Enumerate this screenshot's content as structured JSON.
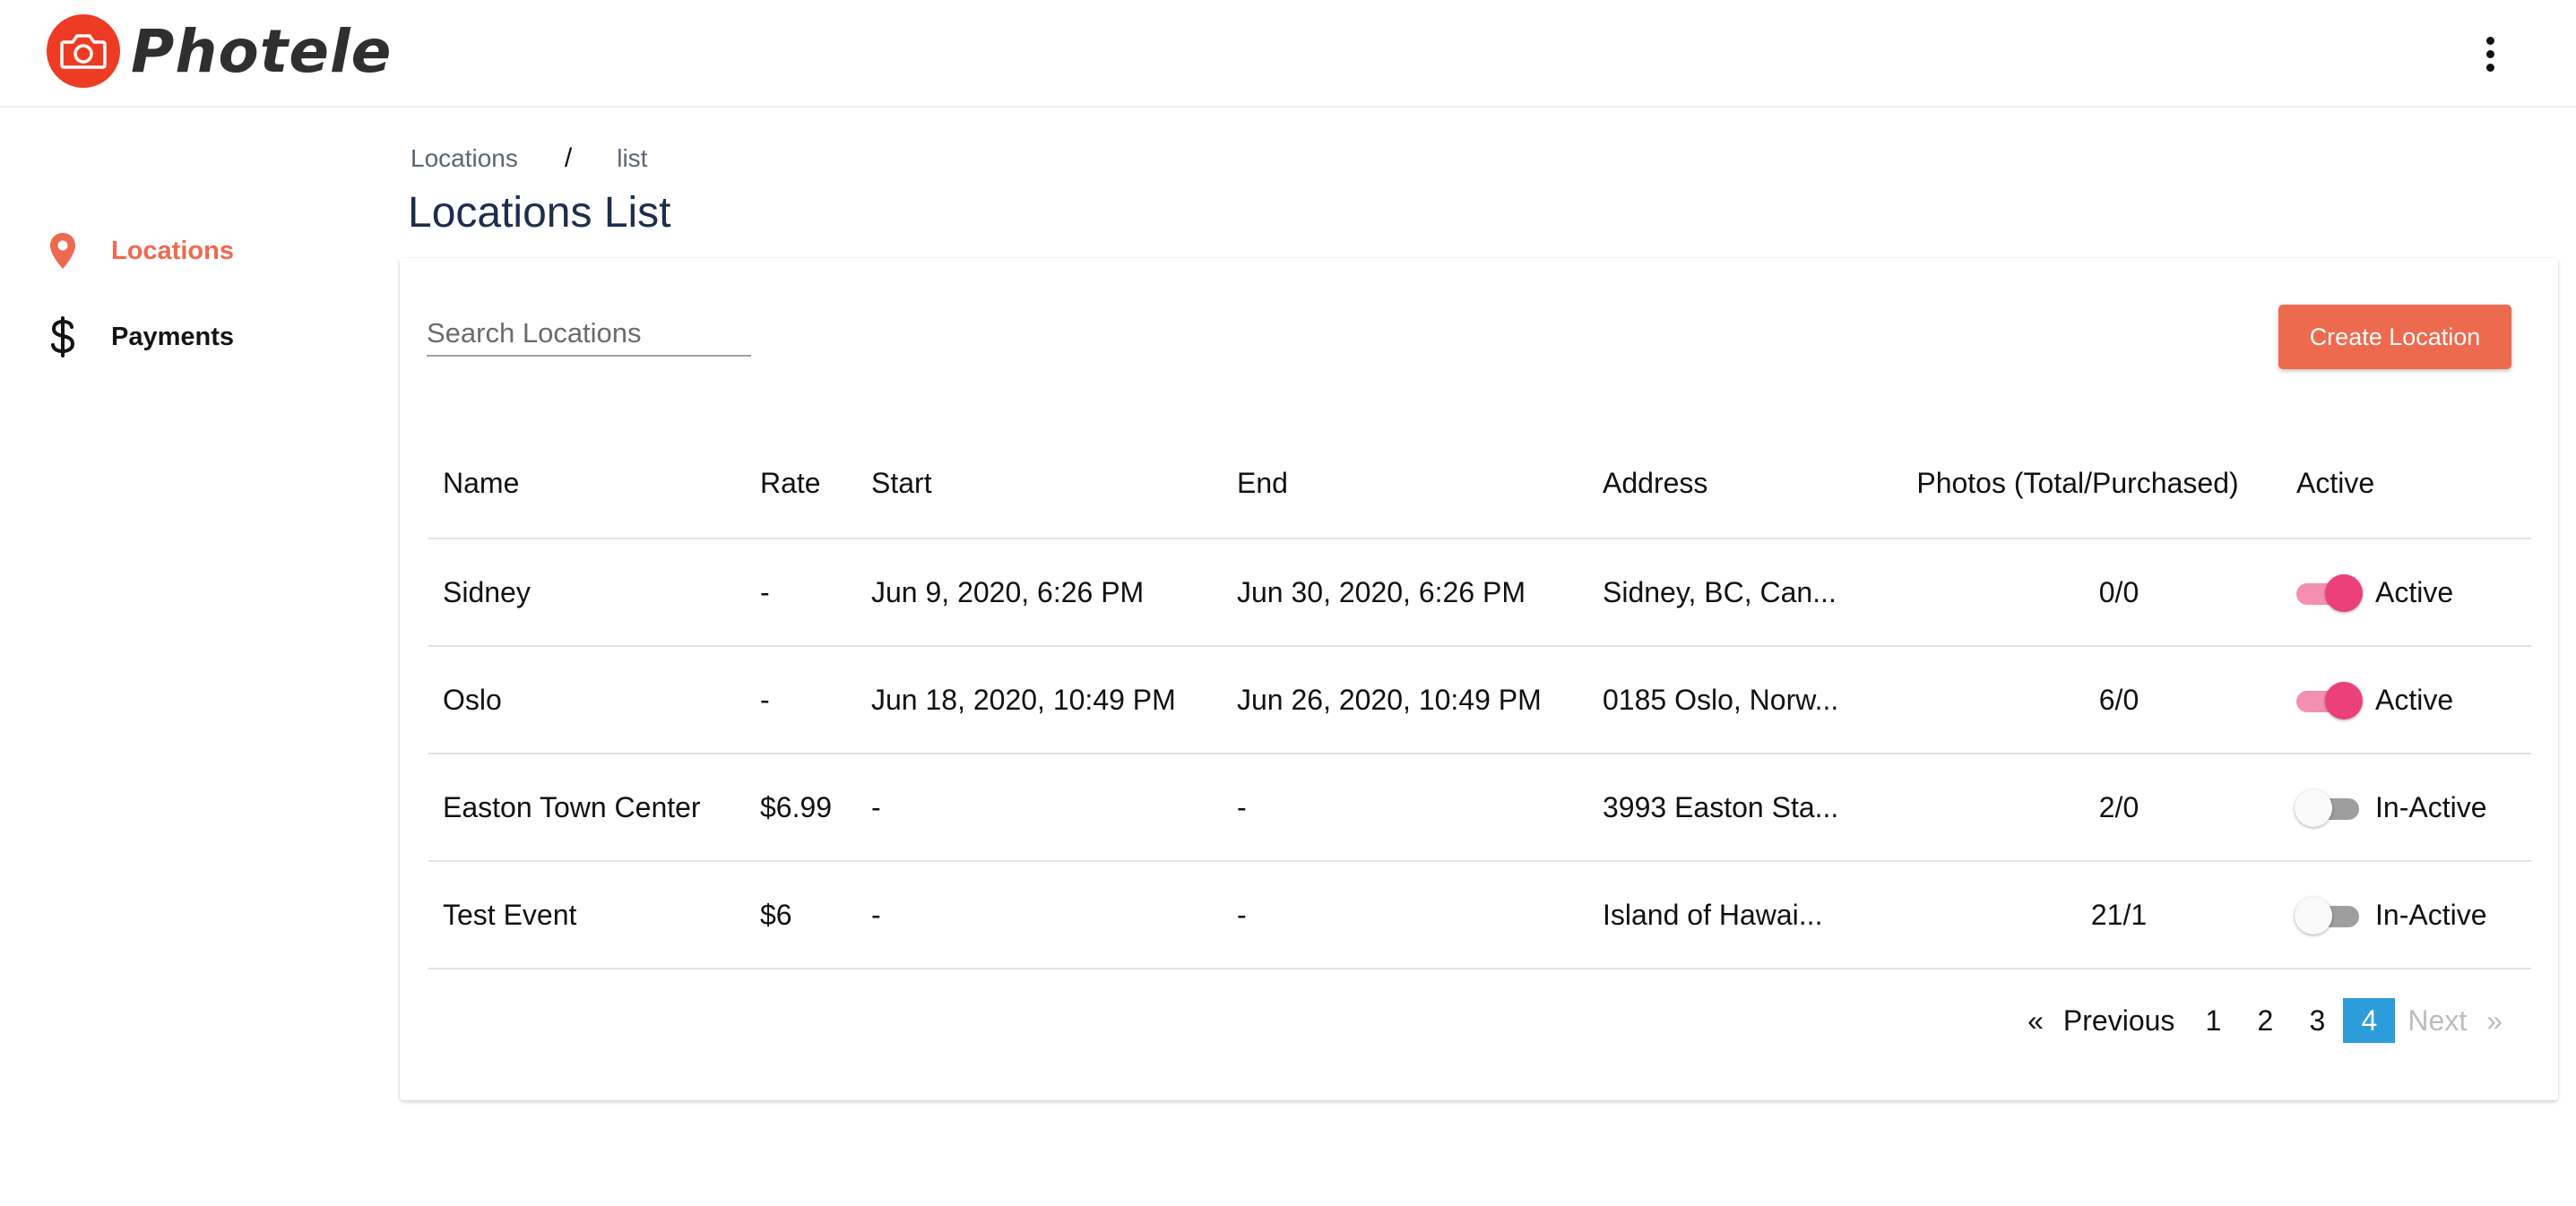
{
  "app": {
    "brand": "Photele",
    "accent": "#ee6a4f",
    "logo_color": "#ee3b24"
  },
  "sidebar": {
    "items": [
      {
        "label": "Locations",
        "icon": "map-pin-icon",
        "active": true
      },
      {
        "label": "Payments",
        "icon": "dollar-icon",
        "active": false
      }
    ]
  },
  "breadcrumb": {
    "root": "Locations",
    "separator": "/",
    "current": "list"
  },
  "page": {
    "title": "Locations List"
  },
  "search": {
    "placeholder": "Search Locations",
    "value": ""
  },
  "toolbar": {
    "create_label": "Create Location"
  },
  "table": {
    "columns": [
      "Name",
      "Rate",
      "Start",
      "End",
      "Address",
      "Photos (Total/Purchased)",
      "Active"
    ],
    "rows": [
      {
        "name": "Sidney",
        "rate": "-",
        "start": "Jun 9, 2020, 6:26 PM",
        "end": "Jun 30, 2020, 6:26 PM",
        "address": "Sidney, BC, Can...",
        "photos": "0/0",
        "active": true,
        "active_label": "Active"
      },
      {
        "name": "Oslo",
        "rate": "-",
        "start": "Jun 18, 2020, 10:49 PM",
        "end": "Jun 26, 2020, 10:49 PM",
        "address": "0185 Oslo, Norw...",
        "photos": "6/0",
        "active": true,
        "active_label": "Active"
      },
      {
        "name": "Easton Town Center",
        "rate": "$6.99",
        "start": "-",
        "end": "-",
        "address": "3993 Easton Sta...",
        "photos": "2/0",
        "active": false,
        "active_label": "In-Active"
      },
      {
        "name": "Test Event",
        "rate": "$6",
        "start": "-",
        "end": "-",
        "address": "Island of Hawai...",
        "photos": "21/1",
        "active": false,
        "active_label": "In-Active"
      }
    ]
  },
  "pagination": {
    "prev_arrow": "«",
    "prev_label": "Previous",
    "pages": [
      "1",
      "2",
      "3",
      "4"
    ],
    "current": "4",
    "next_label": "Next",
    "next_arrow": "»"
  }
}
